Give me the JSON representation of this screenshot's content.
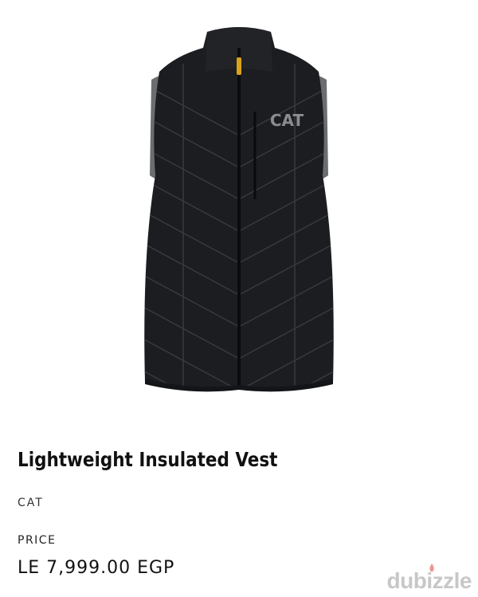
{
  "product": {
    "title": "Lightweight Insulated Vest",
    "brand": "CAT",
    "price_label": "PRICE",
    "price": "LE 7,999.00 EGP",
    "image_logo": "CAT"
  },
  "watermark": {
    "text": "dubizzle",
    "accent_color": "#e0413a"
  },
  "colors": {
    "vest_body": "#1c1d21",
    "vest_lining": "#6b6d70",
    "zipper_pull": "#d9a21b",
    "logo": "#8a8c8f"
  }
}
